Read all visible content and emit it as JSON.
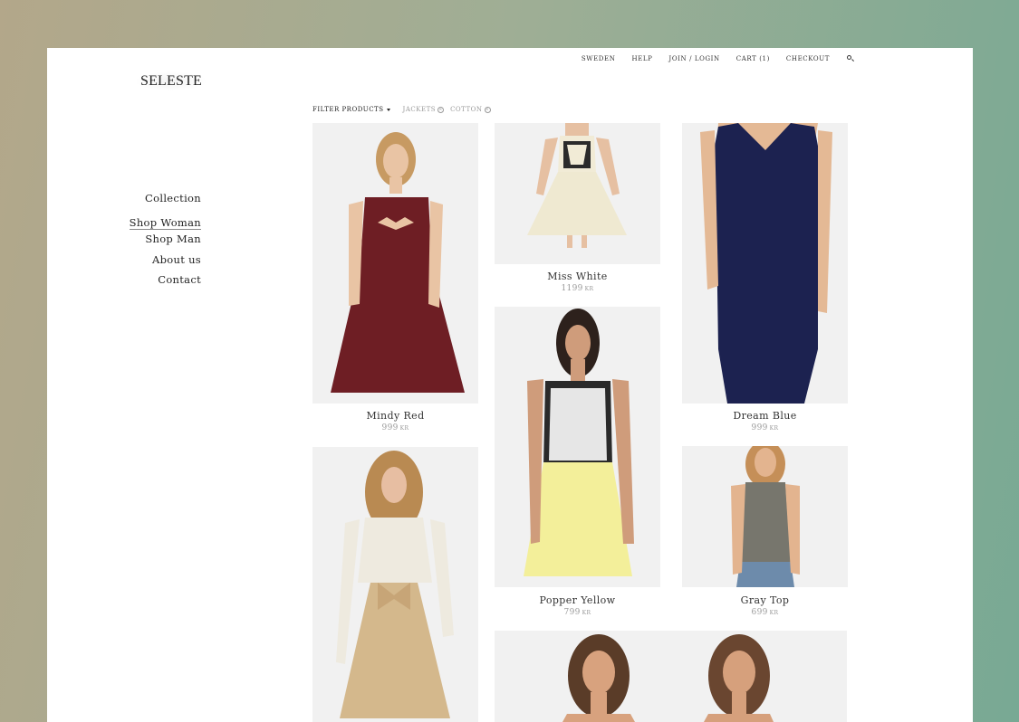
{
  "logo": {
    "text": "SELESTE"
  },
  "topnav": {
    "items": [
      "SWEDEN",
      "HELP",
      "JOIN / LOGIN",
      "CART (1)",
      "CHECKOUT"
    ]
  },
  "sidenav": {
    "items": [
      "Collection",
      "Shop Woman",
      "Shop Man",
      "About us",
      "Contact"
    ],
    "active": "Shop Woman"
  },
  "filters": {
    "label": "FILTER PRODUCTS",
    "chips": [
      "JACKETS",
      "COTTON"
    ]
  },
  "products": [
    {
      "name": "Mindy Red",
      "price": "999",
      "currency": "KR",
      "color": "#6e1e24"
    },
    {
      "name": "Miss White",
      "price": "1199",
      "currency": "KR",
      "color": "#efe9d1"
    },
    {
      "name": "Dream Blue",
      "price": "999",
      "currency": "KR",
      "color": "#1c2250"
    },
    {
      "name": "Popper Yellow",
      "price": "799",
      "currency": "KR",
      "color": "#f3ef9a"
    },
    {
      "name": "Gray Top",
      "price": "699",
      "currency": "KR",
      "color": "#77766d"
    },
    {
      "name": "",
      "price": "",
      "currency": "",
      "color": "#d4b88c"
    },
    {
      "name": "",
      "price": "",
      "currency": "",
      "color": "#8a6a4e"
    }
  ],
  "icons": {
    "search": "search-icon",
    "filter_caret": "chevron-down-icon",
    "chip_remove": "close-circle-icon"
  }
}
